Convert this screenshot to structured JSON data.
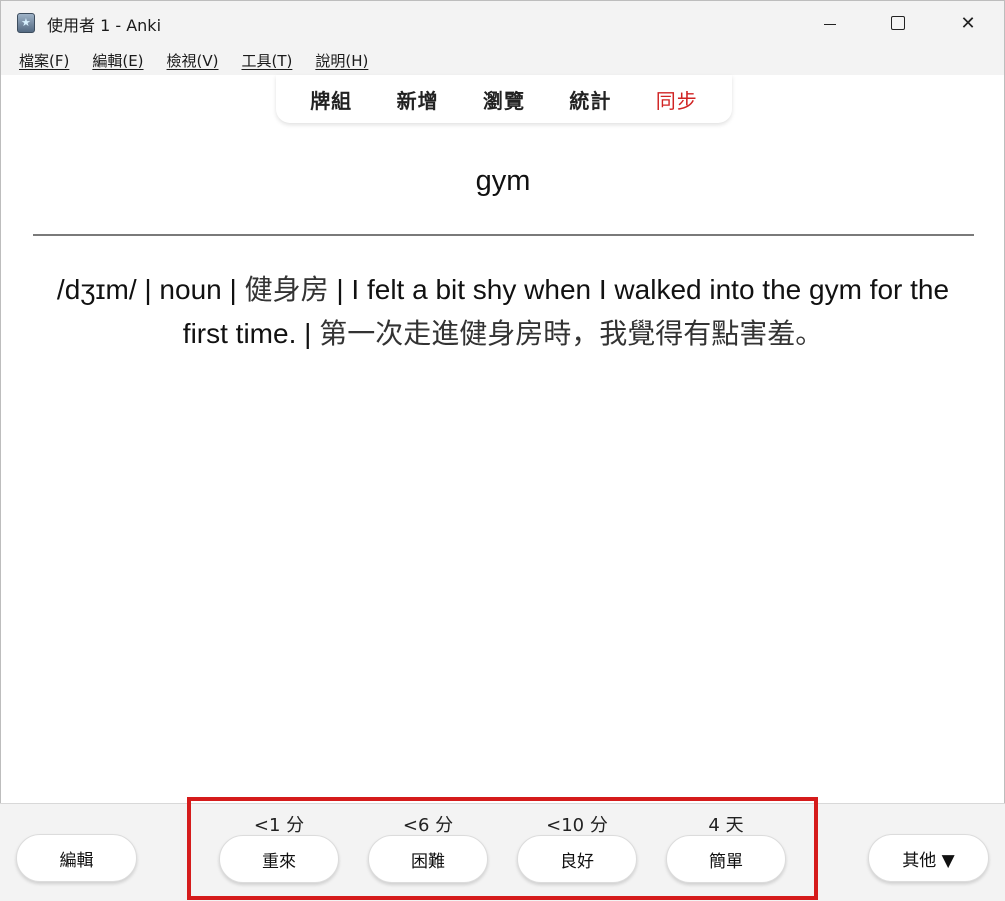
{
  "window": {
    "title": "使用者 1 - Anki",
    "controls": {
      "minimize": "minimize",
      "maximize": "maximize",
      "close": "✕"
    }
  },
  "menu": {
    "items": [
      "檔案(F)",
      "編輯(E)",
      "檢視(V)",
      "工具(T)",
      "說明(H)"
    ]
  },
  "toolbar": {
    "items": [
      "牌組",
      "新增",
      "瀏覽",
      "統計",
      "同步"
    ],
    "sync_color": "#d02323"
  },
  "card": {
    "question": "gym",
    "answer_en_1": "/dʒɪm/ | noun | ",
    "answer_zh_1": "健身房",
    "answer_en_2": " | I felt a bit shy when I walked into the gym for the first time. | ",
    "answer_zh_2": "第一次走進健身房時，我覺得有點害羞。"
  },
  "bottom": {
    "edit_label": "編輯",
    "more_label": "其他 ▼",
    "ease": [
      {
        "interval": "<1 分",
        "label": "重來"
      },
      {
        "interval": "<6 分",
        "label": "困難"
      },
      {
        "interval": "<10 分",
        "label": "良好"
      },
      {
        "interval": "4 天",
        "label": "簡單"
      }
    ],
    "highlight_color": "#d51b1b"
  }
}
